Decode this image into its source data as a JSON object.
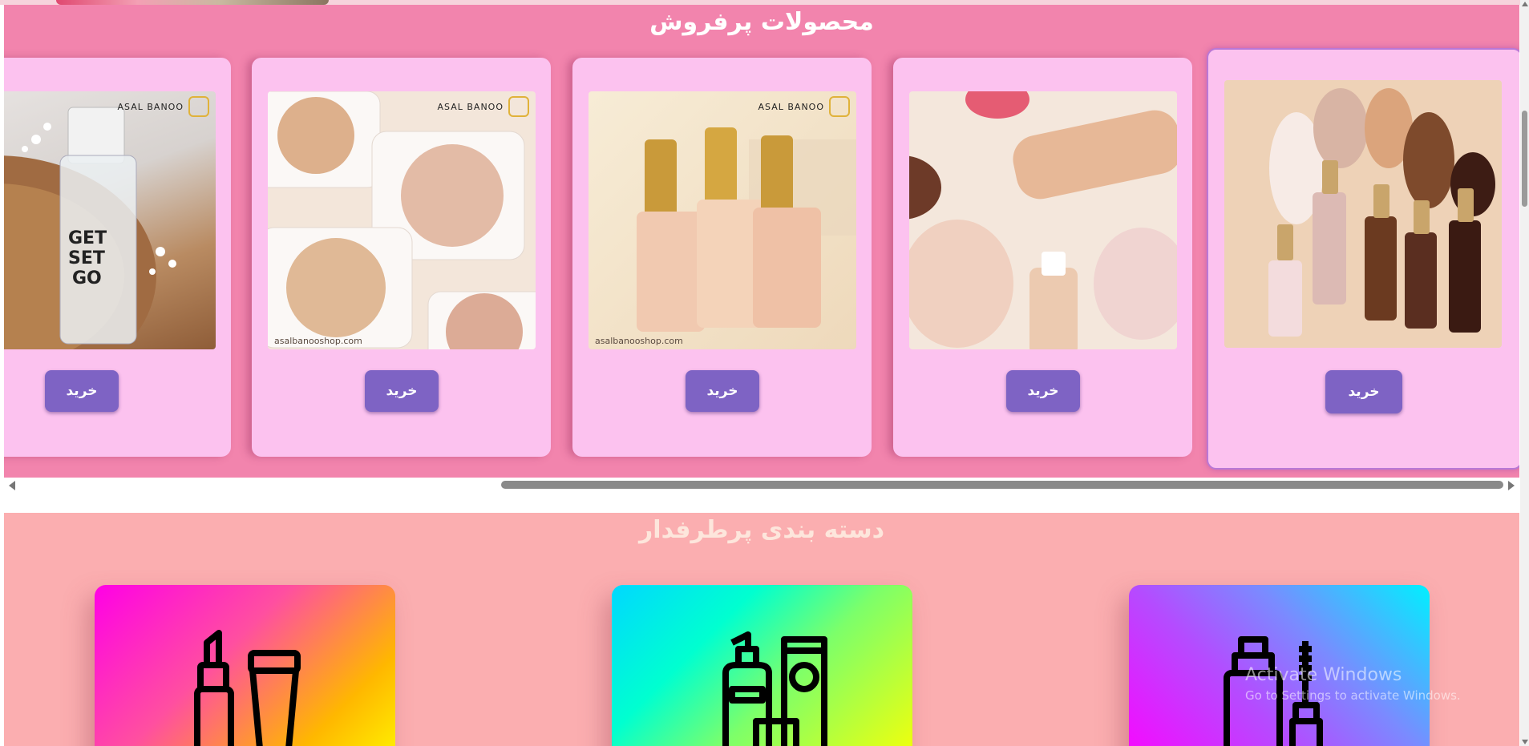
{
  "bestsellers": {
    "title": "محصولات پرفروش",
    "buy_label": "خرید",
    "brand_text": "ASAL BANOO",
    "site_text": "asalbanooshop.com"
  },
  "categories": {
    "title": "دسته بندی پرطرفدار",
    "items": [
      {
        "icon": "lipstick-cream-icon"
      },
      {
        "icon": "skincare-bottles-icon"
      },
      {
        "icon": "mascara-bottle-icon"
      }
    ]
  },
  "watermark": {
    "line1": "Activate Windows",
    "line2": "Go to Settings to activate Windows."
  }
}
